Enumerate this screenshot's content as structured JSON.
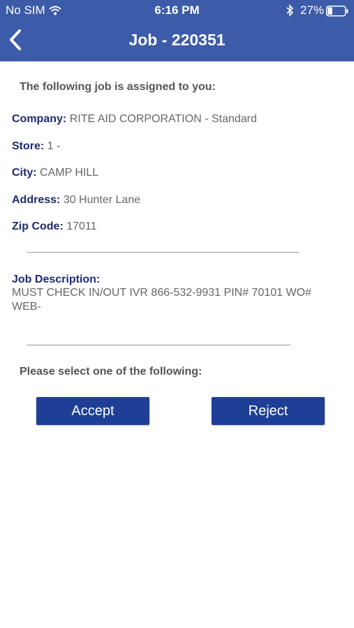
{
  "status_bar": {
    "carrier": "No SIM",
    "wifi_icon": "wifi-icon",
    "time": "6:16 PM",
    "bluetooth_icon": "bluetooth-icon",
    "battery_percent": "27%",
    "battery_level": 0.27
  },
  "nav": {
    "back_icon": "chevron-left-icon",
    "title": "Job - 220351"
  },
  "job": {
    "intro": "The following job is assigned to you:",
    "company_label": "Company:",
    "company_value": "RITE AID CORPORATION - Standard",
    "store_label": "Store:",
    "store_value": "1 -",
    "city_label": "City:",
    "city_value": "CAMP HILL",
    "address_label": "Address:",
    "address_value": "30 Hunter Lane",
    "zip_label": "Zip Code:",
    "zip_value": "17011",
    "description_label": "Job Description:",
    "description_value": "MUST CHECK IN/OUT IVR 866-532-9931 PIN# 70101 WO# WEB-"
  },
  "actions": {
    "prompt": "Please select one of the following:",
    "accept_label": "Accept",
    "reject_label": "Reject"
  },
  "colors": {
    "header_bg": "#3c5ba8",
    "label_color": "#1f2a70",
    "button_bg": "#1e3f95"
  }
}
